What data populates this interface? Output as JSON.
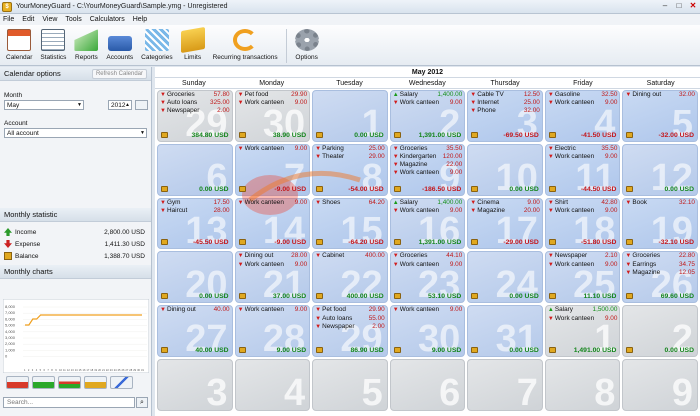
{
  "window": {
    "title": "YourMoneyGuard - C:\\YourMoneyGuard\\Sample.ymg - Unregistered"
  },
  "menu": [
    "File",
    "Edit",
    "View",
    "Tools",
    "Calculators",
    "Help"
  ],
  "toolbar": [
    "Calendar",
    "Statistics",
    "Reports",
    "Accounts",
    "Categories",
    "Limits",
    "Recurring transactions",
    "Options"
  ],
  "calendar_options": {
    "title": "Calendar options",
    "refresh_label": "Refresh Calendar",
    "month_label": "Month",
    "month_value": "May",
    "year_value": "2012",
    "account_label": "Account",
    "account_value": "All account"
  },
  "monthly_statistic": {
    "title": "Monthly statistic",
    "rows": [
      {
        "label": "Income",
        "value": "2,800.00 USD",
        "color": "#2a9a2a"
      },
      {
        "label": "Expense",
        "value": "1,411.30 USD",
        "color": "#cc2222"
      },
      {
        "label": "Balance",
        "value": "1,388.70 USD",
        "color": "#e0a820"
      }
    ]
  },
  "monthly_charts": {
    "title": "Monthly charts",
    "y_ticks": [
      "8,000",
      "7,000",
      "6,000",
      "5,000",
      "4,000",
      "3,000",
      "2,000",
      "1,000",
      "0"
    ],
    "x_ticks": [
      "1",
      "2",
      "3",
      "4",
      "5",
      "6",
      "7",
      "8",
      "9",
      "10",
      "11",
      "12",
      "13",
      "14",
      "15",
      "16",
      "17",
      "18",
      "19",
      "20",
      "21",
      "22",
      "23",
      "24",
      "25",
      "26",
      "27",
      "28",
      "29",
      "30",
      "31"
    ]
  },
  "search": {
    "placeholder": "Search..."
  },
  "calendar": {
    "month_title": "May 2012",
    "weekdays": [
      "Sunday",
      "Monday",
      "Tuesday",
      "Wednesday",
      "Thursday",
      "Friday",
      "Saturday"
    ],
    "cells": [
      {
        "day": "29",
        "other": true,
        "total": "384.80 USD",
        "neg": false,
        "tx": [
          [
            "Groceries",
            "57.80",
            "dn"
          ],
          [
            "Auto loans",
            "325.00",
            "dn"
          ],
          [
            "Newspaper",
            "2.00",
            "dn"
          ]
        ]
      },
      {
        "day": "30",
        "other": true,
        "total": "38.90 USD",
        "neg": false,
        "tx": [
          [
            "Pet food",
            "29.90",
            "dn"
          ],
          [
            "Work canteen",
            "9.00",
            "dn"
          ]
        ]
      },
      {
        "day": "1",
        "other": false,
        "total": "0.00 USD",
        "neg": false,
        "tx": []
      },
      {
        "day": "2",
        "other": false,
        "total": "1,391.00 USD",
        "neg": false,
        "tx": [
          [
            "Salary",
            "1,400.00",
            "up"
          ],
          [
            "Work canteen",
            "9.00",
            "dn"
          ]
        ]
      },
      {
        "day": "3",
        "other": false,
        "total": "-69.50 USD",
        "neg": true,
        "tx": [
          [
            "Cable TV",
            "12.50",
            "dn"
          ],
          [
            "Internet",
            "25.00",
            "dn"
          ],
          [
            "Phone",
            "32.00",
            "dn"
          ]
        ]
      },
      {
        "day": "4",
        "other": false,
        "total": "-41.50 USD",
        "neg": true,
        "tx": [
          [
            "Gasoline",
            "32.50",
            "dn"
          ],
          [
            "Work canteen",
            "9.00",
            "dn"
          ]
        ]
      },
      {
        "day": "5",
        "other": false,
        "total": "-32.00 USD",
        "neg": true,
        "tx": [
          [
            "Dining out",
            "32.00",
            "dn"
          ]
        ]
      },
      {
        "day": "6",
        "other": false,
        "total": "0.00 USD",
        "neg": false,
        "tx": []
      },
      {
        "day": "7",
        "other": false,
        "total": "-9.00 USD",
        "neg": true,
        "tx": [
          [
            "Work canteen",
            "9.00",
            "dn"
          ]
        ]
      },
      {
        "day": "8",
        "other": false,
        "total": "-54.00 USD",
        "neg": true,
        "tx": [
          [
            "Parking",
            "25.00",
            "dn"
          ],
          [
            "Theater",
            "29.00",
            "dn"
          ]
        ]
      },
      {
        "day": "9",
        "other": false,
        "total": "-186.50 USD",
        "neg": true,
        "tx": [
          [
            "Groceries",
            "35.50",
            "dn"
          ],
          [
            "Kindergarten",
            "120.00",
            "dn"
          ],
          [
            "Magazine",
            "22.00",
            "dn"
          ],
          [
            "Work canteen",
            "9.00",
            "dn"
          ]
        ]
      },
      {
        "day": "10",
        "other": false,
        "total": "0.00 USD",
        "neg": false,
        "tx": []
      },
      {
        "day": "11",
        "other": false,
        "total": "-44.50 USD",
        "neg": true,
        "tx": [
          [
            "Electric",
            "35.50",
            "dn"
          ],
          [
            "Work canteen",
            "9.00",
            "dn"
          ]
        ]
      },
      {
        "day": "12",
        "other": false,
        "total": "0.00 USD",
        "neg": false,
        "tx": []
      },
      {
        "day": "13",
        "other": false,
        "total": "-45.50 USD",
        "neg": true,
        "tx": [
          [
            "Gym",
            "17.50",
            "dn"
          ],
          [
            "Haircut",
            "28.00",
            "dn"
          ]
        ]
      },
      {
        "day": "14",
        "other": false,
        "total": "-9.00 USD",
        "neg": true,
        "tx": [
          [
            "Work canteen",
            "9.00",
            "dn"
          ]
        ]
      },
      {
        "day": "15",
        "other": false,
        "total": "-64.20 USD",
        "neg": true,
        "tx": [
          [
            "Shoes",
            "64.20",
            "dn"
          ]
        ]
      },
      {
        "day": "16",
        "other": false,
        "total": "1,391.00 USD",
        "neg": false,
        "tx": [
          [
            "Salary",
            "1,400.00",
            "up"
          ],
          [
            "Work canteen",
            "9.00",
            "dn"
          ]
        ]
      },
      {
        "day": "17",
        "other": false,
        "total": "-29.00 USD",
        "neg": true,
        "tx": [
          [
            "Cinema",
            "9.00",
            "dn"
          ],
          [
            "Magazine",
            "20.00",
            "dn"
          ]
        ]
      },
      {
        "day": "18",
        "other": false,
        "total": "-51.80 USD",
        "neg": true,
        "tx": [
          [
            "Shirt",
            "42.80",
            "dn"
          ],
          [
            "Work canteen",
            "9.00",
            "dn"
          ]
        ]
      },
      {
        "day": "19",
        "other": false,
        "total": "-32.10 USD",
        "neg": true,
        "tx": [
          [
            "Book",
            "32.10",
            "dn"
          ]
        ]
      },
      {
        "day": "20",
        "other": false,
        "total": "0.00 USD",
        "neg": false,
        "tx": []
      },
      {
        "day": "21",
        "other": false,
        "total": "37.00 USD",
        "neg": false,
        "tx": [
          [
            "Dining out",
            "28.00",
            "dn"
          ],
          [
            "Work canteen",
            "9.00",
            "dn"
          ]
        ]
      },
      {
        "day": "22",
        "other": false,
        "total": "400.00 USD",
        "neg": false,
        "tx": [
          [
            "Cabinet",
            "400.00",
            "dn"
          ]
        ]
      },
      {
        "day": "23",
        "other": false,
        "total": "53.10 USD",
        "neg": false,
        "tx": [
          [
            "Groceries",
            "44.10",
            "dn"
          ],
          [
            "Work canteen",
            "9.00",
            "dn"
          ]
        ]
      },
      {
        "day": "24",
        "other": false,
        "total": "0.00 USD",
        "neg": false,
        "tx": []
      },
      {
        "day": "25",
        "other": false,
        "total": "11.10 USD",
        "neg": false,
        "tx": [
          [
            "Newspaper",
            "2.10",
            "dn"
          ],
          [
            "Work canteen",
            "9.00",
            "dn"
          ]
        ]
      },
      {
        "day": "26",
        "other": false,
        "total": "69.60 USD",
        "neg": false,
        "tx": [
          [
            "Groceries",
            "22.80",
            "dn"
          ],
          [
            "Earrings",
            "34.75",
            "dn"
          ],
          [
            "Magazine",
            "12.05",
            "dn"
          ]
        ]
      },
      {
        "day": "27",
        "other": false,
        "total": "40.00 USD",
        "neg": false,
        "tx": [
          [
            "Dining out",
            "40.00",
            "dn"
          ]
        ]
      },
      {
        "day": "28",
        "other": false,
        "total": "9.00 USD",
        "neg": false,
        "tx": [
          [
            "Work canteen",
            "9.00",
            "dn"
          ]
        ]
      },
      {
        "day": "29",
        "other": false,
        "total": "86.90 USD",
        "neg": false,
        "tx": [
          [
            "Pet food",
            "29.90",
            "dn"
          ],
          [
            "Auto loans",
            "55.00",
            "dn"
          ],
          [
            "Newspaper",
            "2.00",
            "dn"
          ]
        ]
      },
      {
        "day": "30",
        "other": false,
        "total": "9.00 USD",
        "neg": false,
        "tx": [
          [
            "Work canteen",
            "9.00",
            "dn"
          ]
        ]
      },
      {
        "day": "31",
        "other": false,
        "total": "0.00 USD",
        "neg": false,
        "tx": []
      },
      {
        "day": "1",
        "other": true,
        "total": "1,491.00 USD",
        "neg": false,
        "tx": [
          [
            "Salary",
            "1,500.00",
            "up"
          ],
          [
            "Work canteen",
            "9.00",
            "dn"
          ]
        ]
      },
      {
        "day": "2",
        "other": true,
        "total": "0.00 USD",
        "neg": false,
        "tx": []
      },
      {
        "day": "3",
        "other": true,
        "total": "",
        "neg": false,
        "tx": []
      },
      {
        "day": "4",
        "other": true,
        "total": "",
        "neg": false,
        "tx": []
      },
      {
        "day": "5",
        "other": true,
        "total": "",
        "neg": false,
        "tx": []
      },
      {
        "day": "6",
        "other": true,
        "total": "",
        "neg": false,
        "tx": []
      },
      {
        "day": "7",
        "other": true,
        "total": "",
        "neg": false,
        "tx": []
      },
      {
        "day": "8",
        "other": true,
        "total": "",
        "neg": false,
        "tx": []
      },
      {
        "day": "9",
        "other": true,
        "total": "",
        "neg": false,
        "tx": []
      }
    ]
  },
  "colors": {
    "income": "#15901b",
    "expense": "#c01818",
    "accent": "#f0a020",
    "cell": "#b4c9ea"
  }
}
